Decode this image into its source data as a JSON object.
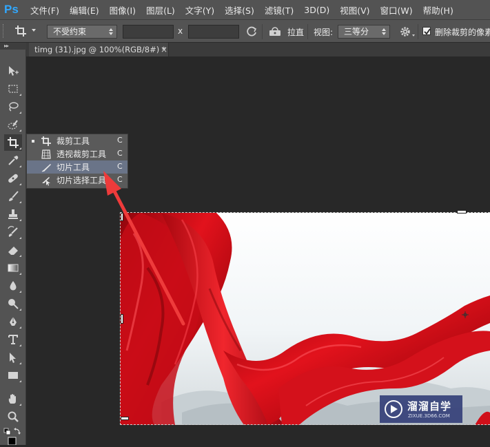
{
  "app": {
    "logo": "Ps"
  },
  "menu": [
    "文件(F)",
    "编辑(E)",
    "图像(I)",
    "图层(L)",
    "文字(Y)",
    "选择(S)",
    "滤镜(T)",
    "3D(D)",
    "视图(V)",
    "窗口(W)",
    "帮助(H)"
  ],
  "options": {
    "ratio_value": "不受约束",
    "x_sign": "x",
    "straighten_label": "拉直",
    "view_label": "视图:",
    "view_value": "三等分",
    "delete_cropped_label": "删除裁剪的像素",
    "delete_cropped_checked": true
  },
  "document": {
    "tab_title": "timg (31).jpg @ 100%(RGB/8#) *",
    "tab_close": "×"
  },
  "toolbar": {
    "grip": "▸▸",
    "tools": [
      "move-icon",
      "marquee-icon",
      "lasso-icon",
      "quick-selection-icon",
      "crop-icon",
      "eyedropper-icon",
      "healing-brush-icon",
      "brush-icon",
      "clone-stamp-icon",
      "history-brush-icon",
      "eraser-icon",
      "gradient-icon",
      "blur-icon",
      "dodge-icon",
      "pen-icon",
      "type-icon",
      "path-selection-icon",
      "rectangle-icon",
      "hand-icon",
      "zoom-icon"
    ],
    "active_tool": "crop-icon"
  },
  "flyout": {
    "items": [
      {
        "label": "裁剪工具",
        "key": "C",
        "icon": "crop-icon",
        "current": true
      },
      {
        "label": "透视裁剪工具",
        "key": "C",
        "icon": "perspective-crop-icon",
        "current": false
      },
      {
        "label": "切片工具",
        "key": "C",
        "icon": "slice-icon",
        "highlighted": true
      },
      {
        "label": "切片选择工具",
        "key": "C",
        "icon": "slice-select-icon",
        "current": false
      }
    ]
  },
  "watermark": {
    "name": "溜溜自学",
    "url": "ZIXUE.3D66.COM"
  },
  "colors": {
    "ui_bg": "#535353",
    "workspace": "#282828",
    "ps_blue": "#31a8ff",
    "highlight": "#6a7488",
    "annotation_arrow": "#ee3b3b",
    "ribbon_red": "#d8101c"
  }
}
